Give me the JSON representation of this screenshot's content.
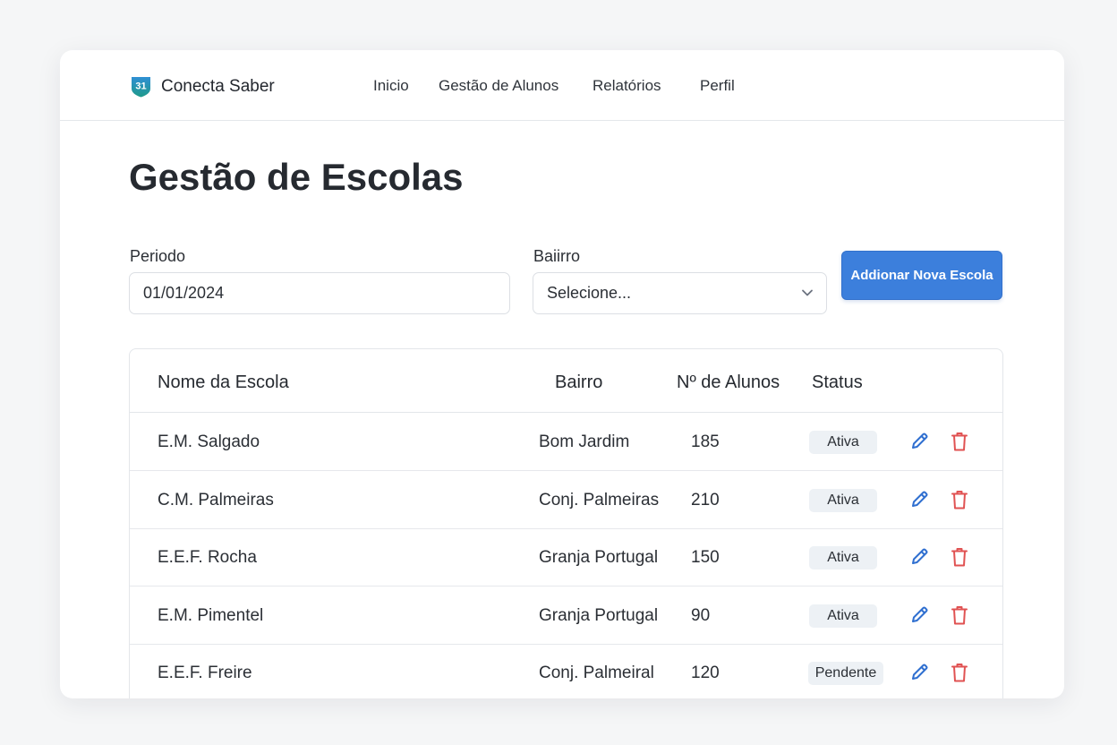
{
  "app": {
    "logo_text": "31",
    "name": "Conecta Saber"
  },
  "nav": {
    "items": [
      {
        "label": "Inicio"
      },
      {
        "label": "Gestão de Alunos"
      },
      {
        "label": "Relatórios"
      },
      {
        "label": "Perfil"
      }
    ]
  },
  "page": {
    "title": "Gestão de Escolas"
  },
  "filters": {
    "period": {
      "label": "Periodo",
      "value": "01/01/2024"
    },
    "neighborhood": {
      "label": "Baiirro",
      "value": "Selecione..."
    },
    "add_button": "Addionar Nova Escola"
  },
  "table": {
    "columns": [
      "Nome da Escola",
      "Bairro",
      "Nº de Alunos",
      "Status"
    ],
    "rows": [
      {
        "name": "E.M. Salgado",
        "bairro": "Bom Jardim",
        "alunos": "185",
        "status": "Ativa"
      },
      {
        "name": "C.M. Palmeiras",
        "bairro": "Conj. Palmeiras",
        "alunos": "210",
        "status": "Ativa"
      },
      {
        "name": "E.E.F. Rocha",
        "bairro": "Granja Portugal",
        "alunos": "150",
        "status": "Ativa"
      },
      {
        "name": "E.M. Pimentel",
        "bairro": "Granja Portugal",
        "alunos": "90",
        "status": "Ativa"
      },
      {
        "name": "E.E.F. Freire",
        "bairro": "Conj. Palmeiral",
        "alunos": "120",
        "status": "Pendente"
      }
    ]
  },
  "colors": {
    "primary": "#3c7fdc",
    "edit_icon": "#2f6fd0",
    "delete_icon": "#e05252",
    "logo_top": "#2f8fd4",
    "logo_bottom": "#1f9a8a"
  },
  "icons": {
    "edit": "pencil-icon",
    "delete": "trash-icon",
    "dropdown": "chevron-down-icon",
    "logo": "shield-logo-icon"
  }
}
